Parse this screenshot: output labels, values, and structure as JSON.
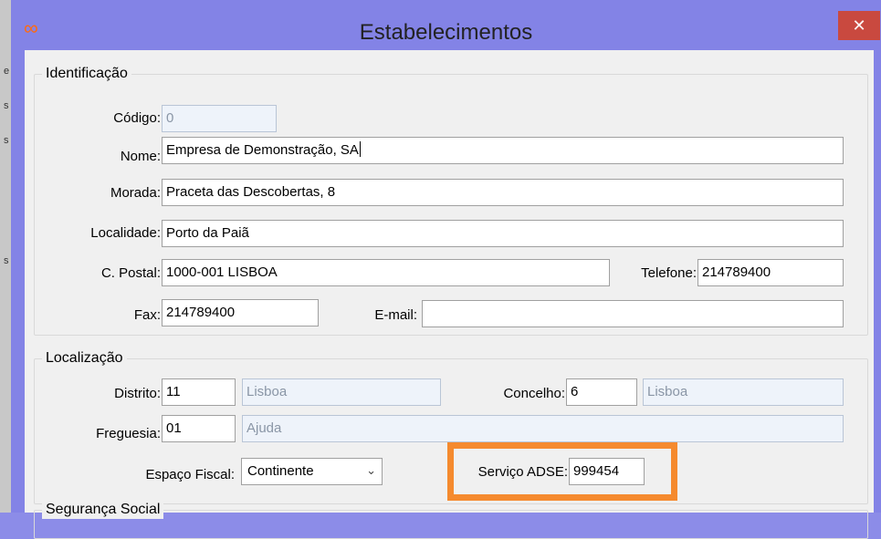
{
  "window": {
    "title": "Estabelecimentos",
    "close_label": "✕",
    "app_icon": "∞"
  },
  "identificacao": {
    "title": "Identificação",
    "codigo_label": "Código:",
    "codigo_value": "0",
    "nome_label": "Nome:",
    "nome_value": "Empresa de Demonstração, SA",
    "morada_label": "Morada:",
    "morada_value": "Praceta das Descobertas, 8",
    "localidade_label": "Localidade:",
    "localidade_value": "Porto da Paiã",
    "cpostal_label": "C. Postal:",
    "cpostal_value": "1000-001 LISBOA",
    "telefone_label": "Telefone:",
    "telefone_value": "214789400",
    "fax_label": "Fax:",
    "fax_value": "214789400",
    "email_label": "E-mail:",
    "email_value": ""
  },
  "localizacao": {
    "title": "Localização",
    "distrito_label": "Distrito:",
    "distrito_code": "11",
    "distrito_name": "Lisboa",
    "concelho_label": "Concelho:",
    "concelho_code": "6",
    "concelho_name": "Lisboa",
    "freguesia_label": "Freguesia:",
    "freguesia_code": "01",
    "freguesia_name": "Ajuda",
    "espaco_label": "Espaço Fiscal:",
    "espaco_value": "Continente",
    "adse_label": "Serviço ADSE:",
    "adse_value": "999454"
  },
  "seguranca": {
    "title": "Segurança Social"
  },
  "colors": {
    "highlight": "#f58a2e",
    "titlebar": "#8383e6",
    "close": "#c9493f"
  }
}
